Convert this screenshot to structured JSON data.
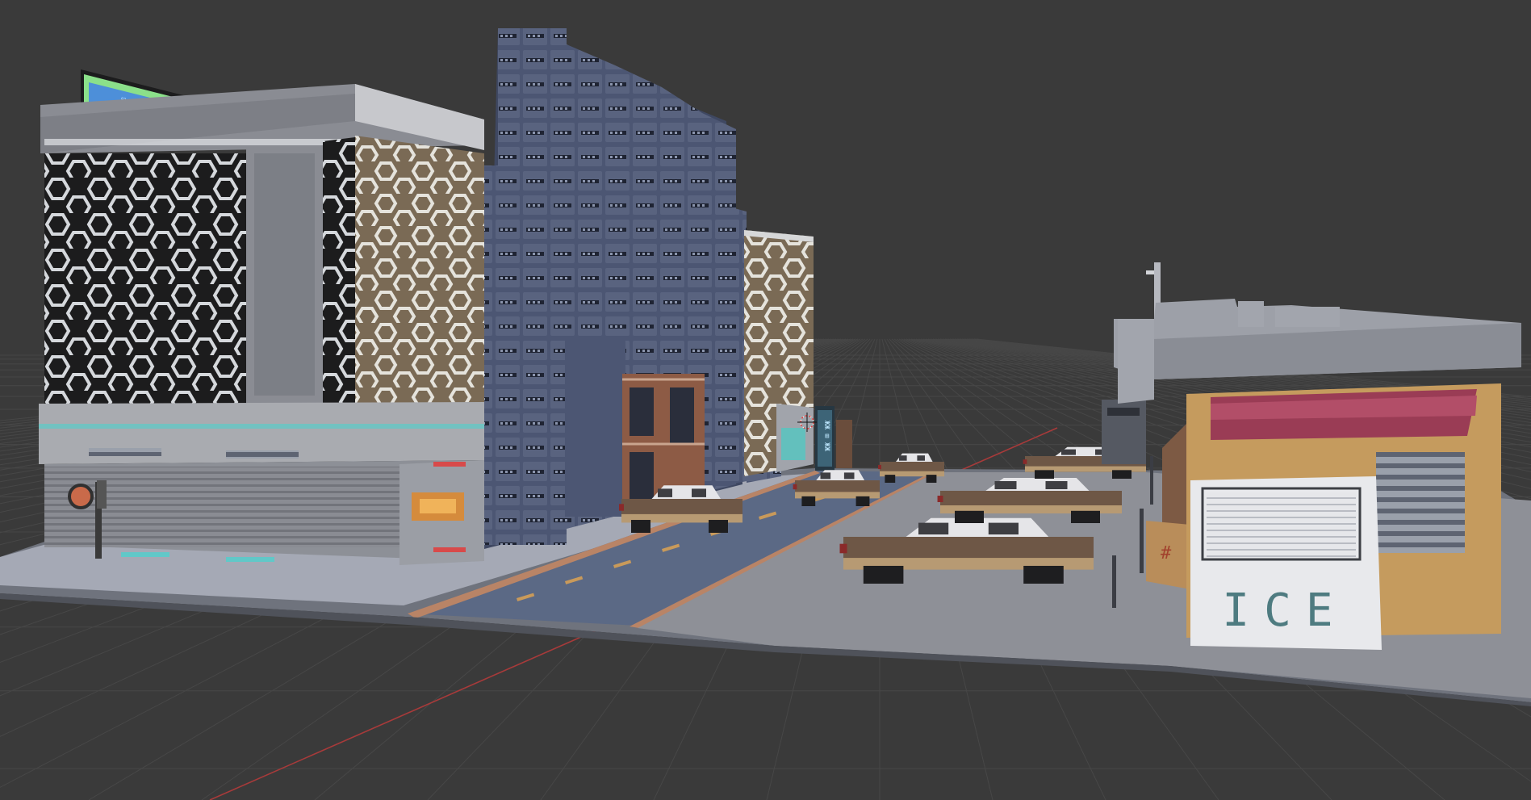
{
  "viewport": {
    "background": "#3a3a3a",
    "grid_color": "#474747",
    "x_axis_color": "#a83a3a"
  },
  "scene": {
    "store_sign_text": "ICE",
    "billboard_text": "▭ ▭▭ ▭▭▭",
    "storefront_sign_text": "ЖЖ ⊞ ЖЖ"
  },
  "colors": {
    "road": "#5b6985",
    "sidewalk": "#a5a9b5",
    "lot": "#8e9097",
    "concrete_building": "#8a8c93",
    "blue_tower": "#4c5673",
    "blue_tower_light": "#5f6a88",
    "brick": "#8d5b45",
    "hut_wall": "#c59b5e",
    "awning": "#9a3c55",
    "car_body": "#6e5746",
    "car_roof": "#e5e5e8"
  }
}
